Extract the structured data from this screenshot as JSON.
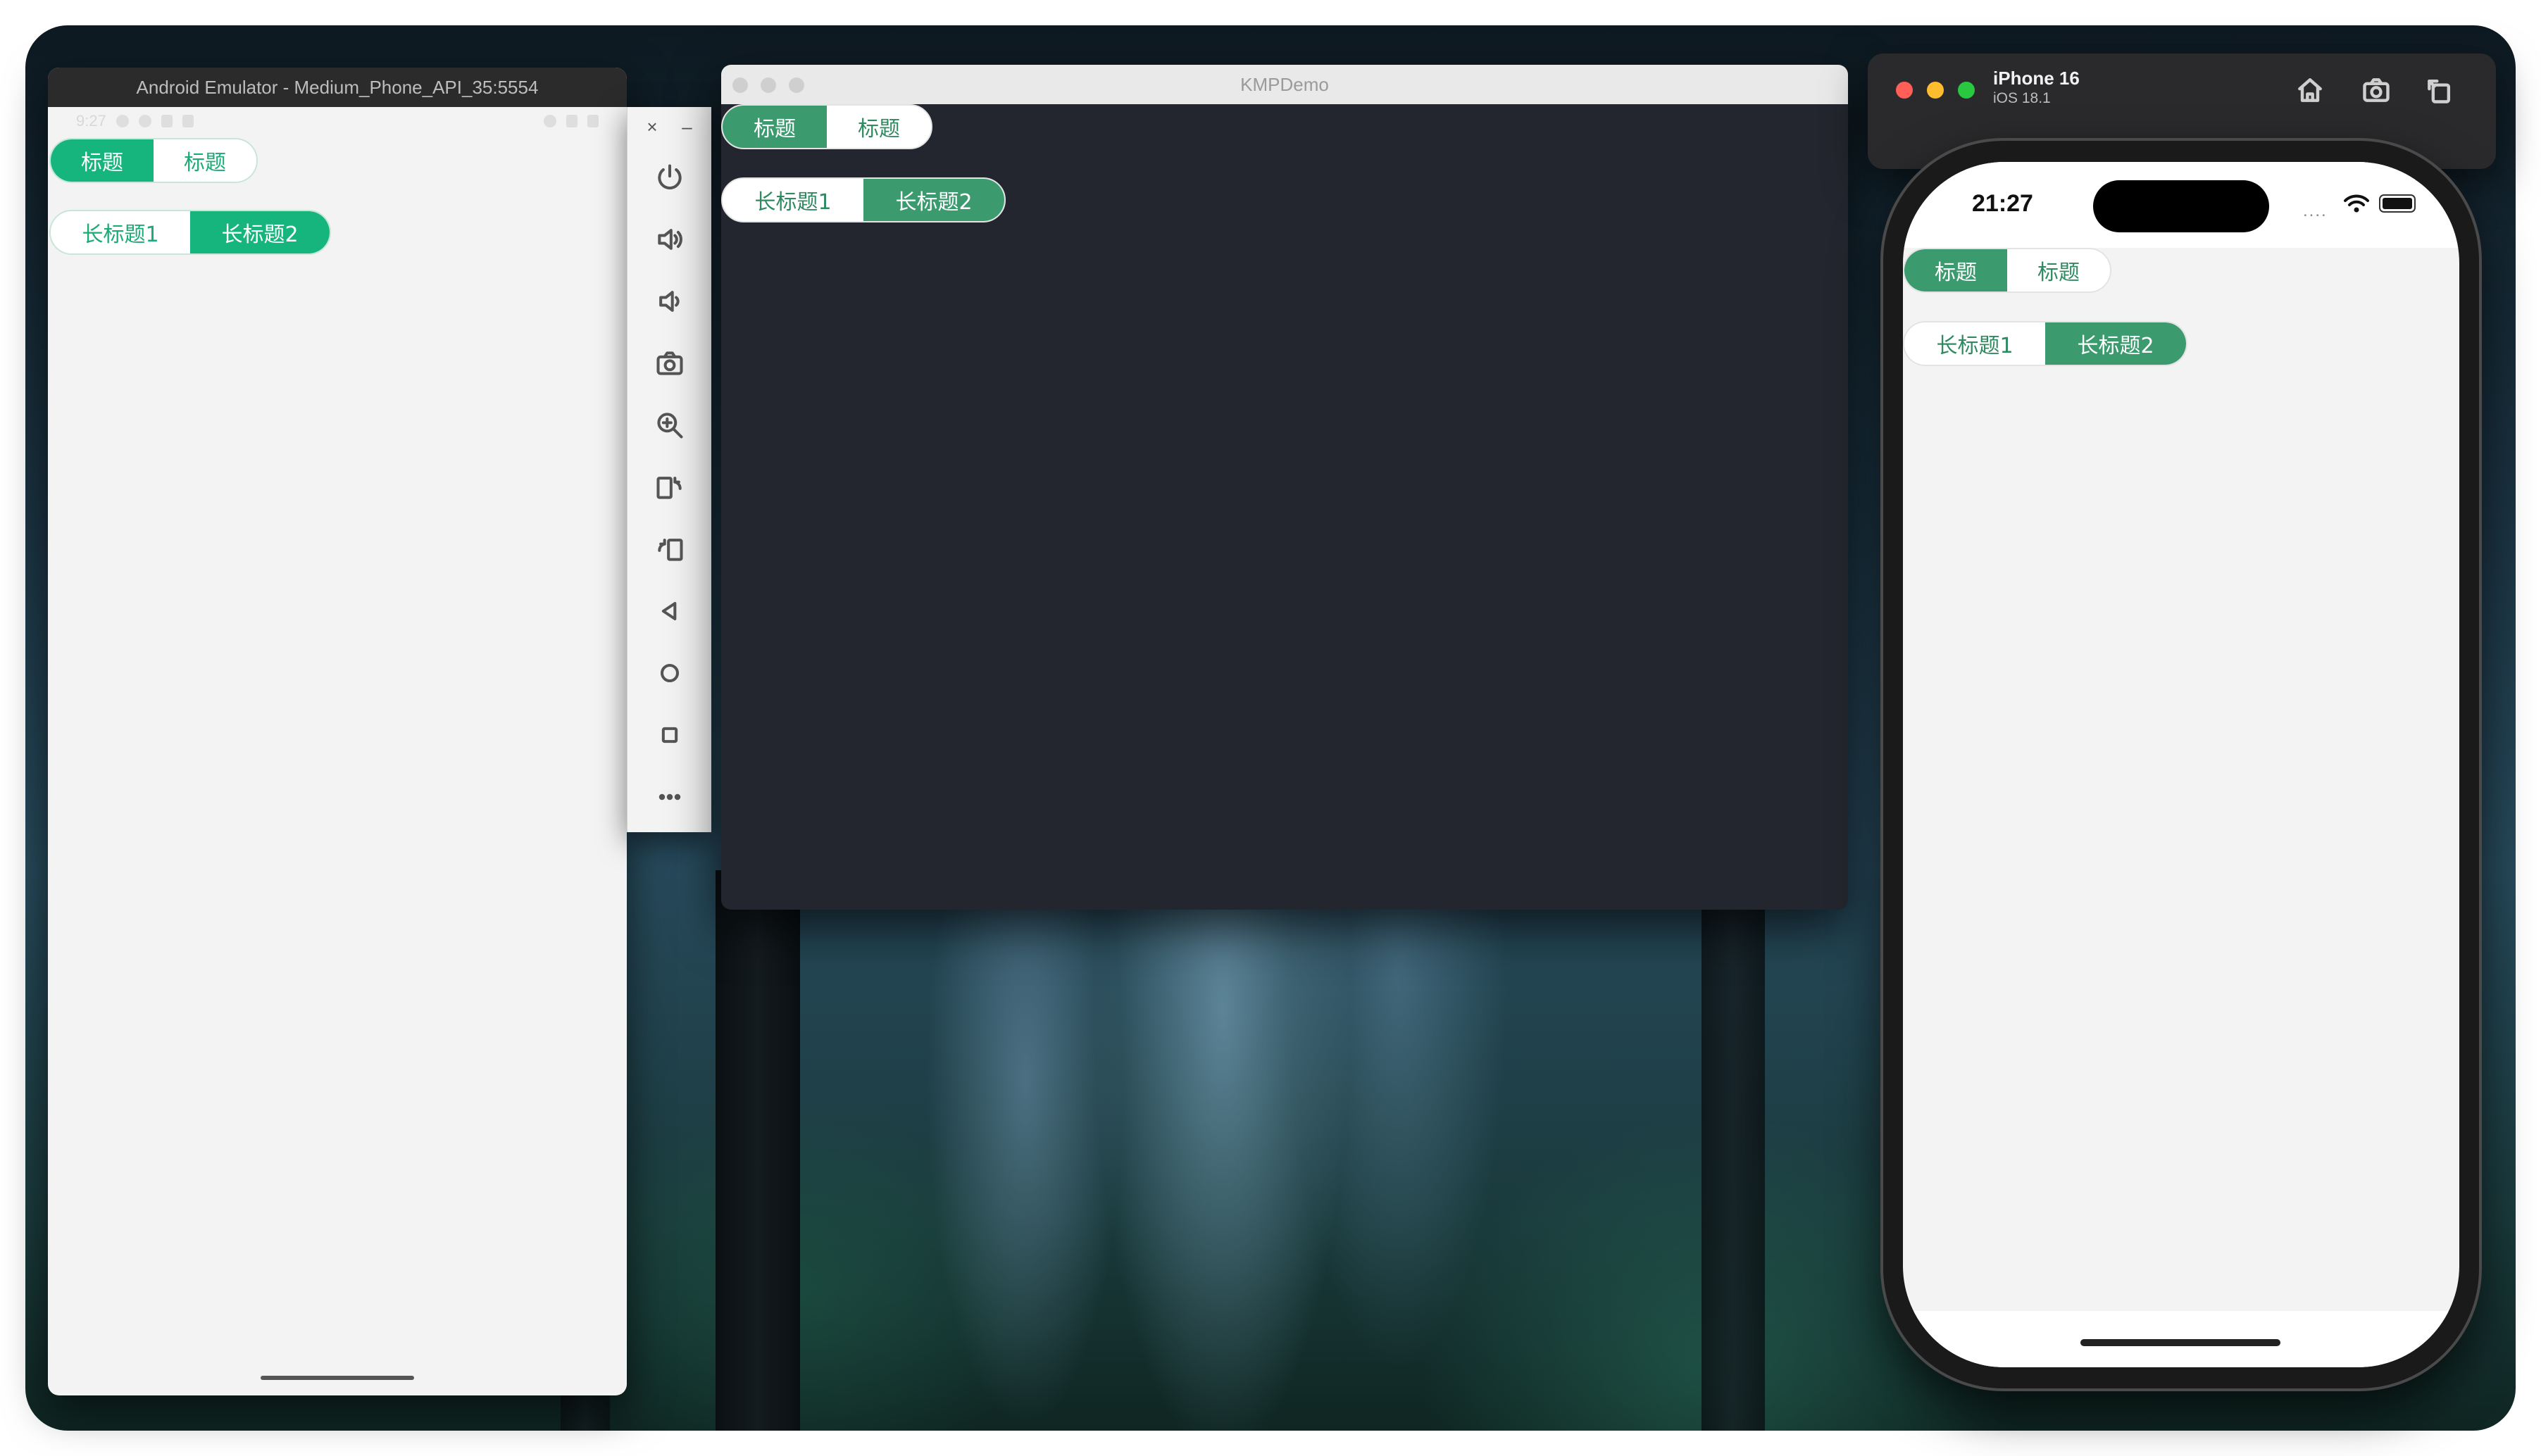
{
  "android": {
    "window_title": "Android Emulator - Medium_Phone_API_35:5554",
    "status_time": "9:27",
    "segment_row1": [
      {
        "label": "标题",
        "selected": true
      },
      {
        "label": "标题",
        "selected": false
      }
    ],
    "segment_row2": [
      {
        "label": "长标题1",
        "selected": false
      },
      {
        "label": "长标题2",
        "selected": true
      }
    ],
    "toolbar": {
      "close_glyph": "×",
      "minimize_glyph": "–",
      "buttons": [
        "power-icon",
        "volume-up-icon",
        "volume-down-icon",
        "camera-icon",
        "zoom-icon",
        "rotate-left-icon",
        "rotate-right-icon",
        "back-icon",
        "home-icon",
        "overview-icon",
        "more-icon"
      ]
    }
  },
  "kmp": {
    "window_title": "KMPDemo",
    "segment_row1": [
      {
        "label": "标题",
        "selected": true
      },
      {
        "label": "标题",
        "selected": false
      }
    ],
    "segment_row2": [
      {
        "label": "长标题1",
        "selected": false
      },
      {
        "label": "长标题2",
        "selected": true
      }
    ]
  },
  "ios": {
    "device_name": "iPhone 16",
    "os_version": "iOS 18.1",
    "status_time": "21:27",
    "signal_glyph": "....",
    "toolbar_icons": [
      "home-icon",
      "screenshot-icon",
      "rotate-icon"
    ],
    "segment_row1": [
      {
        "label": "标题",
        "selected": true
      },
      {
        "label": "标题",
        "selected": false
      }
    ],
    "segment_row2": [
      {
        "label": "长标题1",
        "selected": false
      },
      {
        "label": "长标题2",
        "selected": true
      }
    ]
  },
  "colors": {
    "android_accent": "#15b57d",
    "desktop_accent": "#3b9a6e",
    "kmp_background": "#23262e",
    "traffic_red": "#ff5f57",
    "traffic_yellow": "#febc2e",
    "traffic_green": "#28c840"
  }
}
